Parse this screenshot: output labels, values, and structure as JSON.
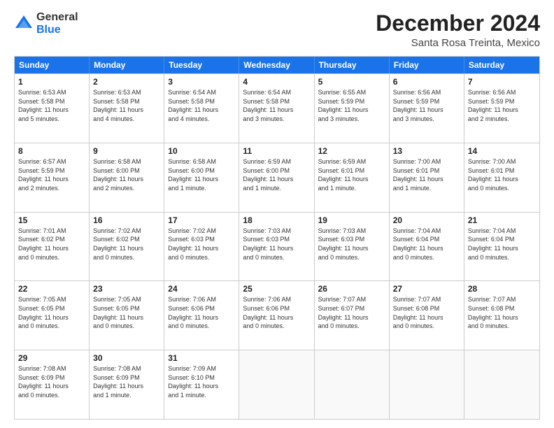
{
  "logo": {
    "general": "General",
    "blue": "Blue"
  },
  "title": "December 2024",
  "location": "Santa Rosa Treinta, Mexico",
  "days_of_week": [
    "Sunday",
    "Monday",
    "Tuesday",
    "Wednesday",
    "Thursday",
    "Friday",
    "Saturday"
  ],
  "weeks": [
    [
      {
        "day": "1",
        "info": "Sunrise: 6:53 AM\nSunset: 5:58 PM\nDaylight: 11 hours\nand 5 minutes."
      },
      {
        "day": "2",
        "info": "Sunrise: 6:53 AM\nSunset: 5:58 PM\nDaylight: 11 hours\nand 4 minutes."
      },
      {
        "day": "3",
        "info": "Sunrise: 6:54 AM\nSunset: 5:58 PM\nDaylight: 11 hours\nand 4 minutes."
      },
      {
        "day": "4",
        "info": "Sunrise: 6:54 AM\nSunset: 5:58 PM\nDaylight: 11 hours\nand 3 minutes."
      },
      {
        "day": "5",
        "info": "Sunrise: 6:55 AM\nSunset: 5:59 PM\nDaylight: 11 hours\nand 3 minutes."
      },
      {
        "day": "6",
        "info": "Sunrise: 6:56 AM\nSunset: 5:59 PM\nDaylight: 11 hours\nand 3 minutes."
      },
      {
        "day": "7",
        "info": "Sunrise: 6:56 AM\nSunset: 5:59 PM\nDaylight: 11 hours\nand 2 minutes."
      }
    ],
    [
      {
        "day": "8",
        "info": "Sunrise: 6:57 AM\nSunset: 5:59 PM\nDaylight: 11 hours\nand 2 minutes."
      },
      {
        "day": "9",
        "info": "Sunrise: 6:58 AM\nSunset: 6:00 PM\nDaylight: 11 hours\nand 2 minutes."
      },
      {
        "day": "10",
        "info": "Sunrise: 6:58 AM\nSunset: 6:00 PM\nDaylight: 11 hours\nand 1 minute."
      },
      {
        "day": "11",
        "info": "Sunrise: 6:59 AM\nSunset: 6:00 PM\nDaylight: 11 hours\nand 1 minute."
      },
      {
        "day": "12",
        "info": "Sunrise: 6:59 AM\nSunset: 6:01 PM\nDaylight: 11 hours\nand 1 minute."
      },
      {
        "day": "13",
        "info": "Sunrise: 7:00 AM\nSunset: 6:01 PM\nDaylight: 11 hours\nand 1 minute."
      },
      {
        "day": "14",
        "info": "Sunrise: 7:00 AM\nSunset: 6:01 PM\nDaylight: 11 hours\nand 0 minutes."
      }
    ],
    [
      {
        "day": "15",
        "info": "Sunrise: 7:01 AM\nSunset: 6:02 PM\nDaylight: 11 hours\nand 0 minutes."
      },
      {
        "day": "16",
        "info": "Sunrise: 7:02 AM\nSunset: 6:02 PM\nDaylight: 11 hours\nand 0 minutes."
      },
      {
        "day": "17",
        "info": "Sunrise: 7:02 AM\nSunset: 6:03 PM\nDaylight: 11 hours\nand 0 minutes."
      },
      {
        "day": "18",
        "info": "Sunrise: 7:03 AM\nSunset: 6:03 PM\nDaylight: 11 hours\nand 0 minutes."
      },
      {
        "day": "19",
        "info": "Sunrise: 7:03 AM\nSunset: 6:03 PM\nDaylight: 11 hours\nand 0 minutes."
      },
      {
        "day": "20",
        "info": "Sunrise: 7:04 AM\nSunset: 6:04 PM\nDaylight: 11 hours\nand 0 minutes."
      },
      {
        "day": "21",
        "info": "Sunrise: 7:04 AM\nSunset: 6:04 PM\nDaylight: 11 hours\nand 0 minutes."
      }
    ],
    [
      {
        "day": "22",
        "info": "Sunrise: 7:05 AM\nSunset: 6:05 PM\nDaylight: 11 hours\nand 0 minutes."
      },
      {
        "day": "23",
        "info": "Sunrise: 7:05 AM\nSunset: 6:05 PM\nDaylight: 11 hours\nand 0 minutes."
      },
      {
        "day": "24",
        "info": "Sunrise: 7:06 AM\nSunset: 6:06 PM\nDaylight: 11 hours\nand 0 minutes."
      },
      {
        "day": "25",
        "info": "Sunrise: 7:06 AM\nSunset: 6:06 PM\nDaylight: 11 hours\nand 0 minutes."
      },
      {
        "day": "26",
        "info": "Sunrise: 7:07 AM\nSunset: 6:07 PM\nDaylight: 11 hours\nand 0 minutes."
      },
      {
        "day": "27",
        "info": "Sunrise: 7:07 AM\nSunset: 6:08 PM\nDaylight: 11 hours\nand 0 minutes."
      },
      {
        "day": "28",
        "info": "Sunrise: 7:07 AM\nSunset: 6:08 PM\nDaylight: 11 hours\nand 0 minutes."
      }
    ],
    [
      {
        "day": "29",
        "info": "Sunrise: 7:08 AM\nSunset: 6:09 PM\nDaylight: 11 hours\nand 0 minutes."
      },
      {
        "day": "30",
        "info": "Sunrise: 7:08 AM\nSunset: 6:09 PM\nDaylight: 11 hours\nand 1 minute."
      },
      {
        "day": "31",
        "info": "Sunrise: 7:09 AM\nSunset: 6:10 PM\nDaylight: 11 hours\nand 1 minute."
      },
      {
        "day": "",
        "info": ""
      },
      {
        "day": "",
        "info": ""
      },
      {
        "day": "",
        "info": ""
      },
      {
        "day": "",
        "info": ""
      }
    ]
  ]
}
